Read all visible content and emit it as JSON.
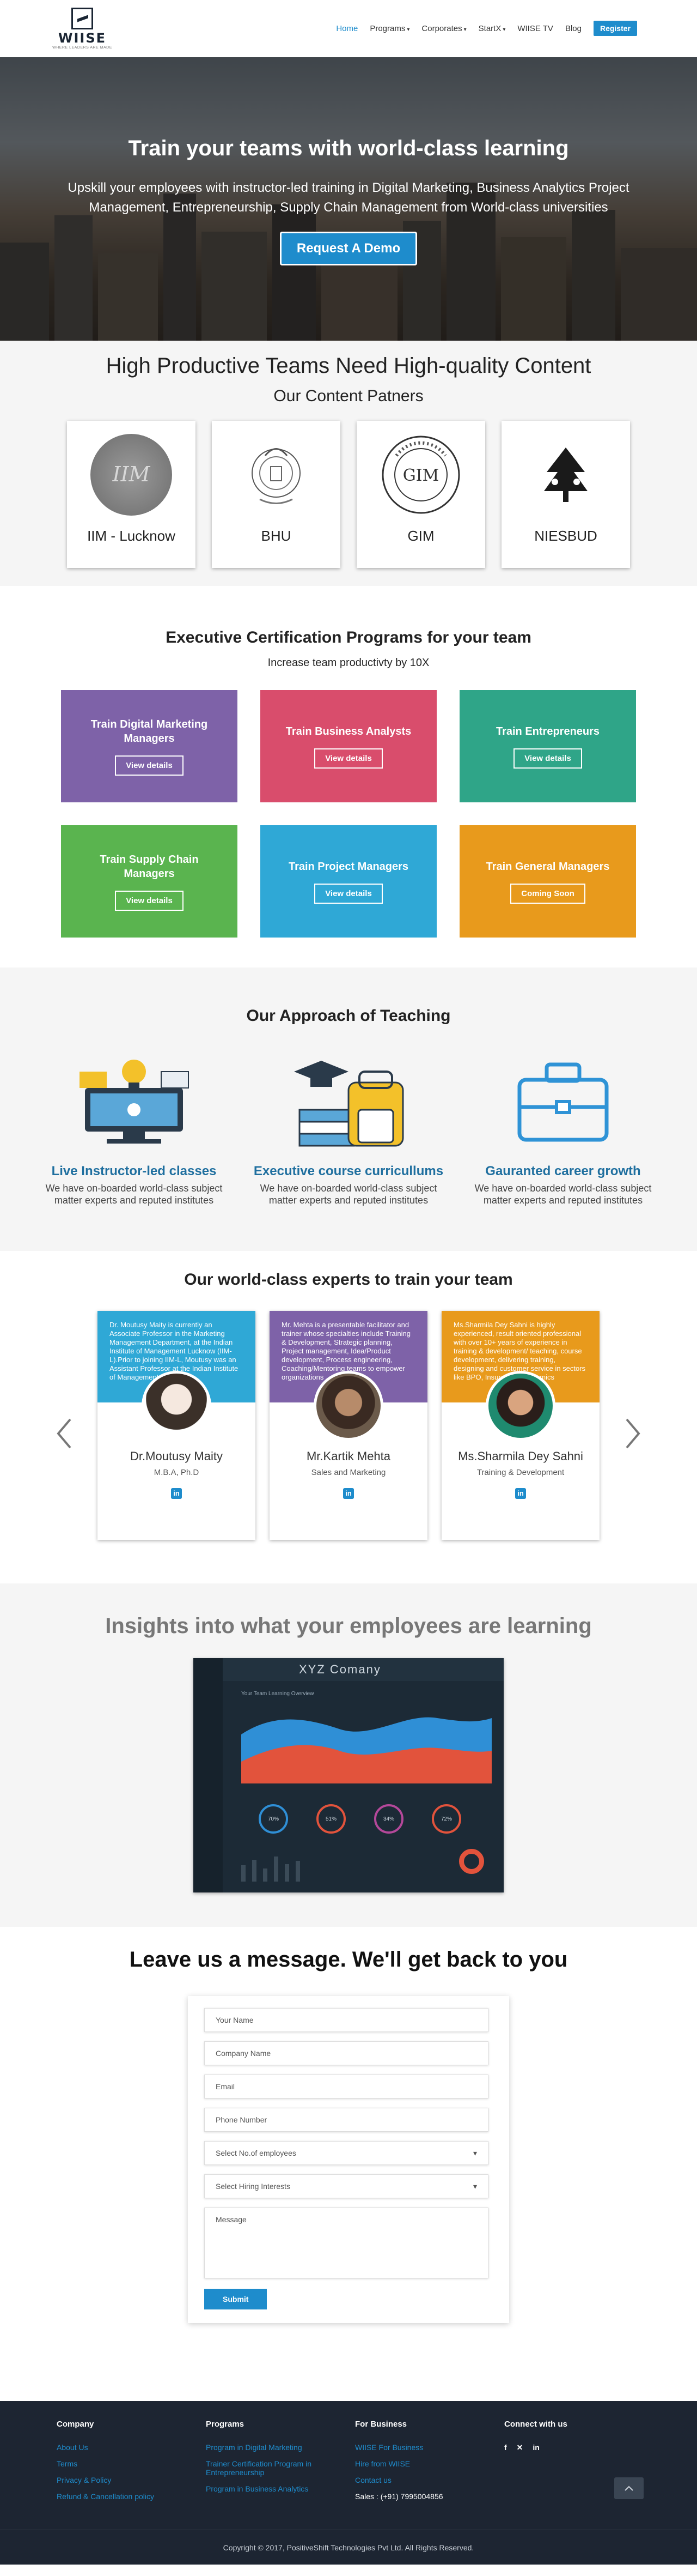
{
  "nav": {
    "logo_name": "WIISE",
    "logo_tagline": "WHERE LEADERS ARE MADE",
    "items": [
      {
        "label": "Home",
        "caret": false
      },
      {
        "label": "Programs",
        "caret": true
      },
      {
        "label": "Corporates",
        "caret": true
      },
      {
        "label": "StartX",
        "caret": true
      },
      {
        "label": "WIISE TV",
        "caret": false
      },
      {
        "label": "Blog",
        "caret": false
      }
    ],
    "register": "Register"
  },
  "hero": {
    "title": "Train your teams with world-class learning",
    "subtitle": "Upskill your employees with instructor-led training in Digital Marketing, Business Analytics Project Management, Entrepreneurship, Supply Chain Management from World-class universities",
    "cta": "Request A Demo"
  },
  "partners": {
    "heading": "High Productive Teams Need High-quality Content",
    "subheading": "Our Content Patners",
    "items": [
      {
        "name": "IIM - Lucknow"
      },
      {
        "name": "BHU"
      },
      {
        "name": "GIM"
      },
      {
        "name": "NIESBUD"
      }
    ]
  },
  "programs": {
    "heading": "Executive Certification Programs for your team",
    "sub": "Increase team productivty by 10X",
    "items": [
      {
        "title": "Train Digital Marketing Managers",
        "button": "View details",
        "color": "#7e62a8"
      },
      {
        "title": "Train Business Analysts",
        "button": "View details",
        "color": "#d94d6c"
      },
      {
        "title": "Train  Entrepreneurs",
        "button": "View details",
        "color": "#2fa588"
      },
      {
        "title": "Train Supply Chain Managers",
        "button": "View details",
        "color": "#5ab44f"
      },
      {
        "title": "Train Project Managers",
        "button": "View details",
        "color": "#2fa8d6"
      },
      {
        "title": "Train General Managers",
        "button": "Coming Soon",
        "color": "#e89a1c"
      }
    ]
  },
  "approach": {
    "heading": "Our Approach of Teaching",
    "items": [
      {
        "title": "Live Instructor-led classes",
        "text": "We have on-boarded world-class subject matter experts and reputed institutes"
      },
      {
        "title": "Executive course curricullums",
        "text": "We have on-boarded world-class subject matter experts and reputed institutes"
      },
      {
        "title": "Gauranted career growth",
        "text": "We have on-boarded world-class subject matter experts and reputed institutes"
      }
    ]
  },
  "experts": {
    "heading": "Our world-class experts to train your team",
    "items": [
      {
        "bio": "Dr. Moutusy Maity is currently an Associate Professor in the Marketing Management Department, at the Indian Institute of Management Lucknow (IIM-L).Prior to joining IIM-L, Moutusy was an Assistant Professor at the Indian Institute of Management",
        "name": "Dr.Moutusy Maity",
        "role": "M.B.A, Ph.D",
        "color": "#2fa8d6"
      },
      {
        "bio": "Mr. Mehta is a presentable facilitator and trainer whose specialties include Training & Development, Strategic planning, Project management, Idea/Product development, Process engineering, Coaching/Mentoring teams to empower organizations",
        "name": "Mr.Kartik Mehta",
        "role": "Sales and Marketing",
        "color": "#7e62a8"
      },
      {
        "bio": "Ms.Sharmila Dey Sahni is highly experienced, result oriented professional with over 10+ years of experience in training & development/ teaching, course development, delivering training, designing and customer service in sectors like BPO, Insurance, Academics",
        "name": "Ms.Sharmila Dey Sahni",
        "role": "Training & Development",
        "color": "#e89a1c"
      }
    ]
  },
  "insights": {
    "heading": "Insights into what your employees are learning",
    "dashboard_title": "XYZ  Comany",
    "chart_title": "Your Team Learning Overview",
    "gauges": [
      "70%",
      "51%",
      "34%",
      "72%"
    ]
  },
  "contact": {
    "heading": "Leave us a message. We'll get back to you",
    "fields": [
      {
        "placeholder": "Your Name",
        "select": false
      },
      {
        "placeholder": "Company Name",
        "select": false
      },
      {
        "placeholder": "Email",
        "select": false
      },
      {
        "placeholder": "Phone Number",
        "select": false
      },
      {
        "placeholder": "Select No.of employees",
        "select": true
      },
      {
        "placeholder": "Select Hiring Interests",
        "select": true
      }
    ],
    "message_placeholder": "Message",
    "submit": "Submit"
  },
  "footer": {
    "columns": [
      {
        "title": "Company",
        "links": [
          "About Us",
          "Terms",
          "Privacy & Policy",
          "Refund & Cancellation policy"
        ]
      },
      {
        "title": "Programs",
        "links": [
          "Program in Digital Marketing",
          "Trainer Certification Program in Entrepreneurship",
          "Program in Business Analytics"
        ]
      },
      {
        "title": "For Business",
        "links": [
          "WIISE For Business",
          "Hire from WIISE",
          "Contact us"
        ],
        "extra": "Sales : (+91) 7995004856"
      },
      {
        "title": "Connect with us",
        "social": [
          "f",
          "✕",
          "in"
        ]
      }
    ],
    "copyright": "Copyright © 2017, PositiveShift Technologies Pvt Ltd. All Rights Reserved."
  },
  "colors": {
    "accent": "#1e8ccc",
    "footer_bg": "#1d2532"
  }
}
